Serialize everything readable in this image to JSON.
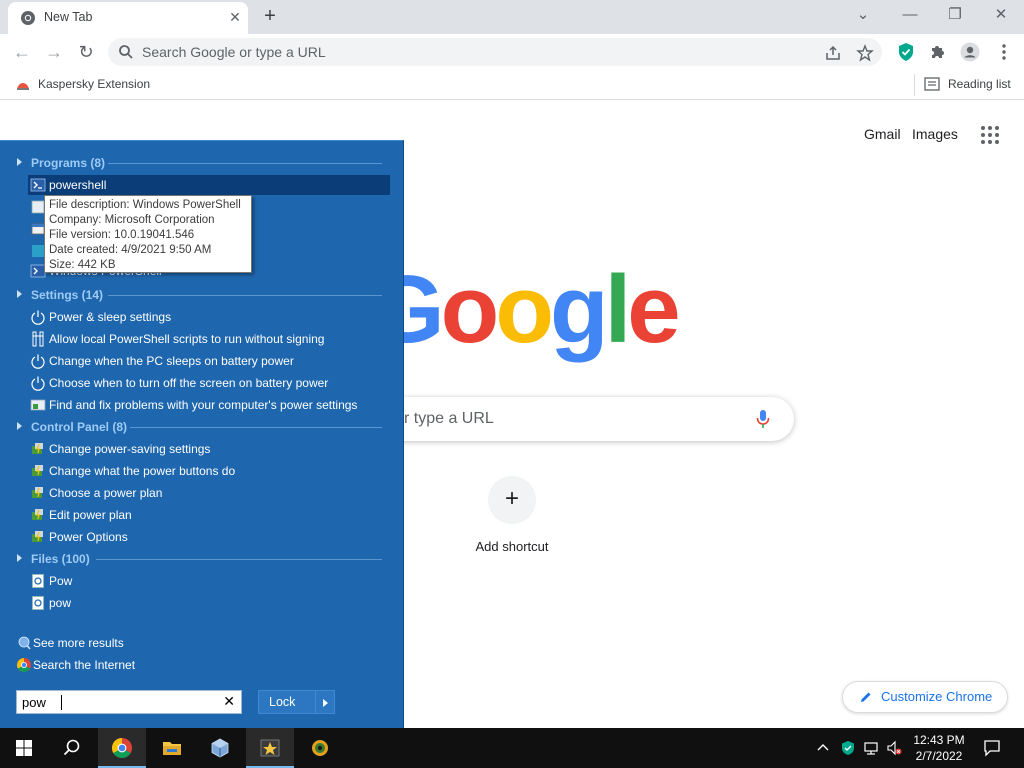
{
  "browser": {
    "tab_title": "New Tab",
    "omnibox_placeholder": "Search Google or type a URL",
    "bookmark_kaspersky": "Kaspersky Extension",
    "reading_list": "Reading list"
  },
  "ntp": {
    "gmail": "Gmail",
    "images": "Images",
    "logo_letters": [
      "G",
      "o",
      "o",
      "g",
      "l",
      "e"
    ],
    "logo_colors": [
      "#4285f4",
      "#ea4335",
      "#fbbc05",
      "#4285f4",
      "#34a853",
      "#ea4335"
    ],
    "search_placeholder_visible": "r type a URL",
    "add_shortcut": "Add shortcut",
    "customize": "Customize Chrome"
  },
  "start_menu": {
    "categories": {
      "programs": "Programs (8)",
      "settings": "Settings (14)",
      "control_panel": "Control Panel (8)",
      "files": "Files (100)"
    },
    "programs": [
      {
        "label": "powershell",
        "icon": "powershell-icon"
      },
      {
        "label": "",
        "icon": "program-icon"
      },
      {
        "label": "",
        "icon": "program-icon"
      },
      {
        "label": "",
        "icon": "program-icon"
      },
      {
        "label": "Windows PowerShell",
        "icon": "powershell-icon"
      }
    ],
    "tooltip": [
      "File description: Windows PowerShell",
      "Company: Microsoft Corporation",
      "File version: 10.0.19041.546",
      "Date created: 4/9/2021 9:50 AM",
      "Size: 442 KB"
    ],
    "settings": [
      "Power & sleep settings",
      "Allow local PowerShell scripts to run without signing",
      "Change when the PC sleeps on battery power",
      "Choose when to turn off the screen on battery power",
      "Find and fix problems with your computer's power settings"
    ],
    "control_panel": [
      "Change power-saving settings",
      "Change what the power buttons do",
      "Choose a power plan",
      "Edit power plan",
      "Power Options"
    ],
    "files": [
      "Pow",
      "pow"
    ],
    "see_more": "See more results",
    "search_internet": "Search the Internet",
    "search_value": "pow",
    "lock": "Lock"
  },
  "taskbar": {
    "time": "12:43 PM",
    "date": "2/7/2022"
  },
  "colors": {
    "start_menu_bg": "#1e66ad",
    "accent_blue": "#1a73e8",
    "taskbar_bg": "#101010"
  }
}
